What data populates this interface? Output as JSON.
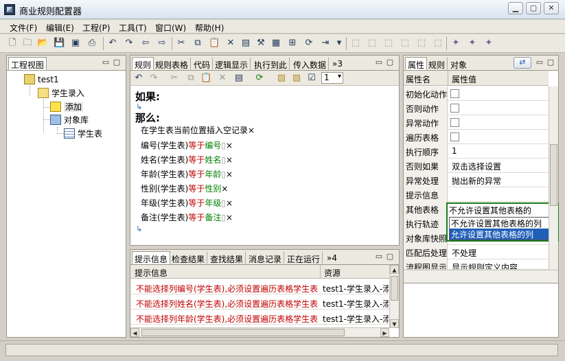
{
  "window": {
    "title": "商业规则配置器"
  },
  "menu": [
    "文件(F)",
    "编辑(E)",
    "工程(P)",
    "工具(T)",
    "窗口(W)",
    "帮助(H)"
  ],
  "project_view": {
    "tab": "工程视图",
    "tree": [
      {
        "label": "test1",
        "level": 0
      },
      {
        "label": "学生录入",
        "level": 1
      },
      {
        "label": "添加",
        "level": 2
      },
      {
        "label": "对象库",
        "level": 2
      },
      {
        "label": "学生表",
        "level": 3
      }
    ]
  },
  "editor": {
    "tabs": [
      "规则",
      "规则表格",
      "代码",
      "逻辑显示",
      "执行到此",
      "传入数据",
      "»3"
    ],
    "zoom": "1",
    "if_label": "如果:",
    "then_label": "那么:",
    "actions": [
      {
        "text": "在学生表当前位置插入空记录",
        "kw": "",
        "value": ""
      },
      {
        "text": "编号(学生表)",
        "kw": "等于",
        "value": "编号"
      },
      {
        "text": "姓名(学生表)",
        "kw": "等于",
        "value": "姓名"
      },
      {
        "text": "年龄(学生表)",
        "kw": "等于",
        "value": "年龄"
      },
      {
        "text": "性别(学生表)",
        "kw": "等于",
        "value": "性别"
      },
      {
        "text": "年级(学生表)",
        "kw": "等于",
        "value": "年级"
      },
      {
        "text": "备注(学生表)",
        "kw": "等于",
        "value": "备注"
      }
    ],
    "delete_mark": "×"
  },
  "messages": {
    "tabs": [
      "提示信息",
      "检查结果",
      "查找结果",
      "消息记录",
      "正在运行",
      "»4"
    ],
    "columns": [
      "提示信息",
      "资源"
    ],
    "rows": [
      {
        "msg": "不能选择列编号(学生表),必须设置遍历表格学生表",
        "res": "test1-学生录入-添"
      },
      {
        "msg": "不能选择列姓名(学生表),必须设置遍历表格学生表",
        "res": "test1-学生录入-添"
      },
      {
        "msg": "不能选择列年龄(学生表),必须设置遍历表格学生表",
        "res": "test1-学生录入-添"
      }
    ]
  },
  "properties": {
    "tabs": [
      "属性",
      "规则",
      "对象"
    ],
    "columns": [
      "属性名",
      "属性值"
    ],
    "rows": [
      {
        "name": "初始化动作",
        "type": "checkbox"
      },
      {
        "name": "否则动作",
        "type": "checkbox"
      },
      {
        "name": "异常动作",
        "type": "checkbox"
      },
      {
        "name": "遍历表格",
        "type": "checkbox"
      },
      {
        "name": "执行顺序",
        "type": "text",
        "value": "1"
      },
      {
        "name": "否则如果",
        "type": "text",
        "value": "双击选择设置"
      },
      {
        "name": "异常处理",
        "type": "text",
        "value": "抛出新的异常"
      },
      {
        "name": "提示信息",
        "type": "text",
        "value": ""
      },
      {
        "name": "其他表格",
        "type": "dropdown",
        "value": "不允许设置其他表格的"
      },
      {
        "name": "执行轨迹",
        "type": "text",
        "value": ""
      },
      {
        "name": "对象库快照",
        "type": "text",
        "value": ""
      },
      {
        "name": "匹配后处理",
        "type": "text",
        "value": "不处理"
      },
      {
        "name": "流程图显示",
        "type": "text",
        "value": "显示规则定义内容"
      }
    ],
    "dropdown_options": [
      "不允许设置其他表格的列",
      "允许设置其他表格的列"
    ],
    "dropdown_highlight": "#1f5fb8",
    "dropdown_border": "#1a7a1a"
  }
}
